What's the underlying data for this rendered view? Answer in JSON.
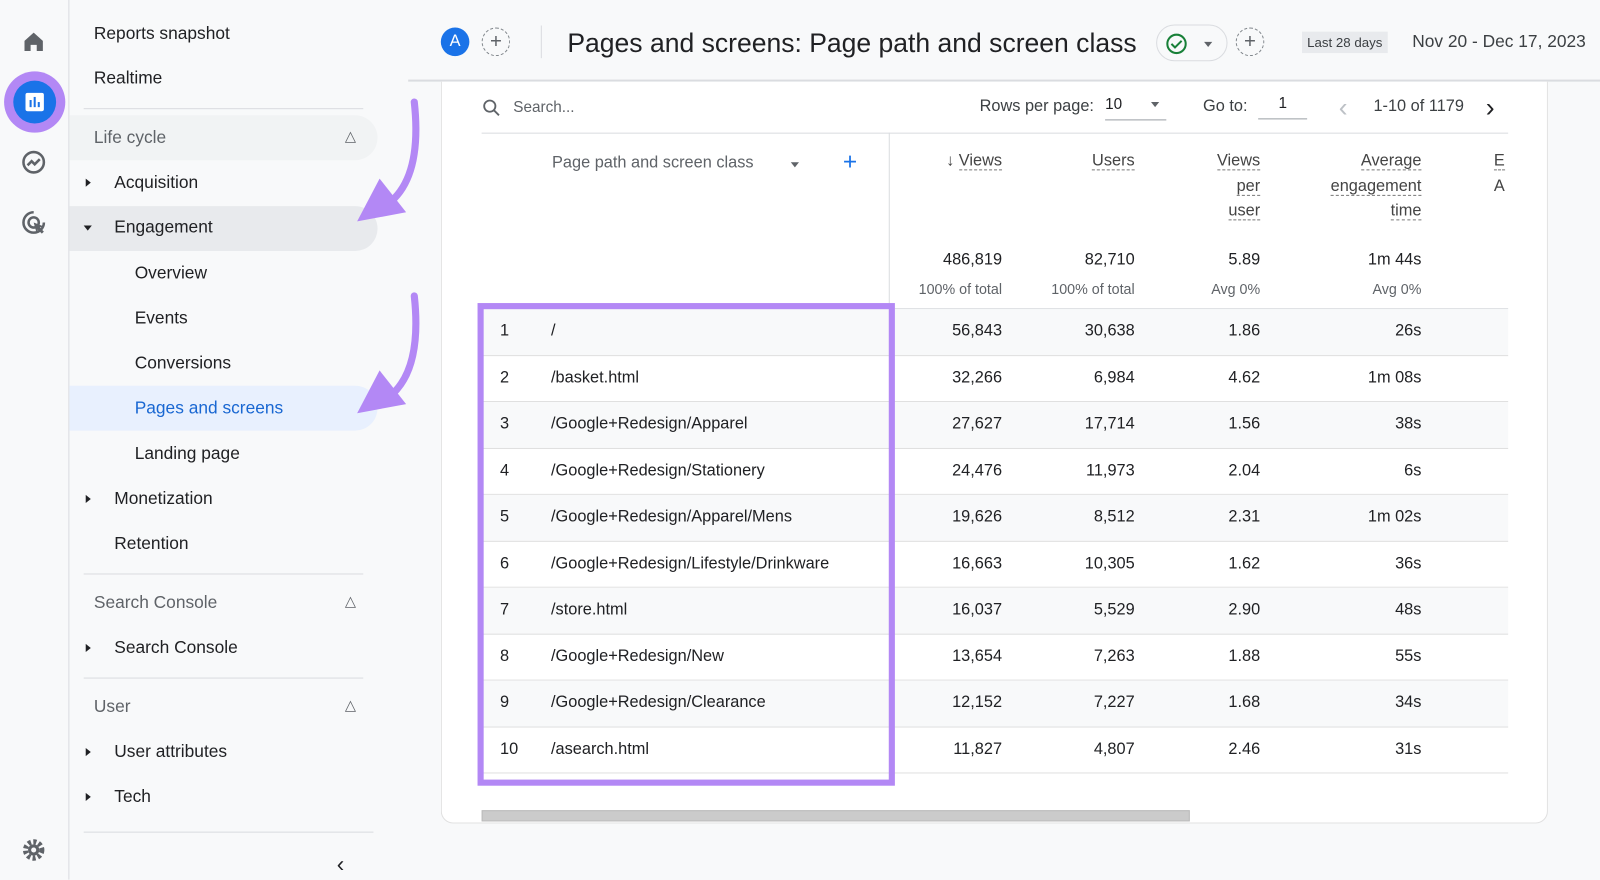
{
  "sidebar": {
    "rail_icons": [
      "home-icon",
      "reports-icon",
      "explore-icon",
      "advertising-icon",
      "settings-icon"
    ],
    "top_items": [
      "Reports snapshot",
      "Realtime"
    ],
    "lifecycle": {
      "label": "Life cycle",
      "items": [
        {
          "label": "Acquisition"
        },
        {
          "label": "Engagement",
          "children": [
            "Overview",
            "Events",
            "Conversions",
            "Pages and screens",
            "Landing page"
          ]
        },
        {
          "label": "Monetization"
        },
        {
          "label": "Retention"
        }
      ]
    },
    "search_console": {
      "label": "Search Console",
      "items": [
        "Search Console"
      ]
    },
    "user": {
      "label": "User",
      "items": [
        "User attributes",
        "Tech"
      ]
    },
    "active_item": "Pages and screens"
  },
  "header": {
    "avatar": "A",
    "title": "Pages and screens: Page path and screen class",
    "date_badge": "Last 28 days",
    "date_range": "Nov 20 - Dec 17, 2023"
  },
  "toolbar": {
    "search_placeholder": "Search...",
    "rows_per_page_label": "Rows per page:",
    "rows_per_page": "10",
    "goto_label": "Go to:",
    "goto_value": "1",
    "pagination": "1-10 of 1179"
  },
  "table": {
    "dimension_header": "Page path and screen class",
    "columns": [
      {
        "label_lines": [
          "Views"
        ],
        "total": "486,819",
        "sub": "100% of total",
        "sorted": true
      },
      {
        "label_lines": [
          "Users"
        ],
        "total": "82,710",
        "sub": "100% of total"
      },
      {
        "label_lines": [
          "Views",
          "per",
          "user"
        ],
        "total": "5.89",
        "sub": "Avg 0%"
      },
      {
        "label_lines": [
          "Average",
          "engagement",
          "time"
        ],
        "total": "1m 44s",
        "sub": "Avg 0%"
      }
    ],
    "cut_column_lines": [
      "E",
      "A"
    ],
    "rows": [
      [
        "1",
        "/",
        "56,843",
        "30,638",
        "1.86",
        "26s"
      ],
      [
        "2",
        "/basket.html",
        "32,266",
        "6,984",
        "4.62",
        "1m 08s"
      ],
      [
        "3",
        "/Google+Redesign/Apparel",
        "27,627",
        "17,714",
        "1.56",
        "38s"
      ],
      [
        "4",
        "/Google+Redesign/Stationery",
        "24,476",
        "11,973",
        "2.04",
        "6s"
      ],
      [
        "5",
        "/Google+Redesign/Apparel/Mens",
        "19,626",
        "8,512",
        "2.31",
        "1m 02s"
      ],
      [
        "6",
        "/Google+Redesign/Lifestyle/Drinkware",
        "16,663",
        "10,305",
        "1.62",
        "36s"
      ],
      [
        "7",
        "/store.html",
        "16,037",
        "5,529",
        "2.90",
        "48s"
      ],
      [
        "8",
        "/Google+Redesign/New",
        "13,654",
        "7,263",
        "1.88",
        "55s"
      ],
      [
        "9",
        "/Google+Redesign/Clearance",
        "12,152",
        "7,227",
        "1.68",
        "34s"
      ],
      [
        "10",
        "/asearch.html",
        "11,827",
        "4,807",
        "2.46",
        "31s"
      ]
    ]
  },
  "colors": {
    "accent": "#1a73e8",
    "highlight": "#b388f5",
    "active_bg": "#e8f0fe",
    "status_green": "#188038"
  }
}
